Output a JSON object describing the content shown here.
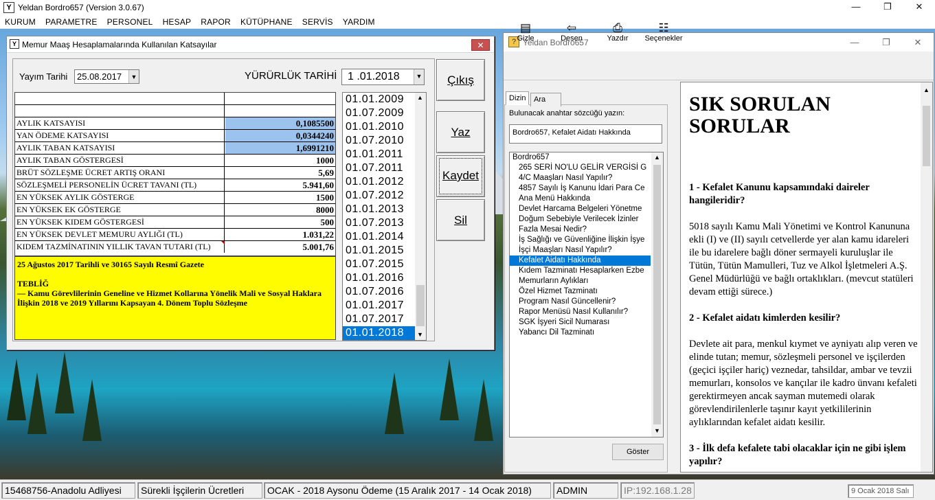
{
  "app": {
    "title": "Yeldan Bordro657 (Version 3.0.67)"
  },
  "menu": [
    "KURUM",
    "PARAMETRE",
    "PERSONEL",
    "HESAP",
    "RAPOR",
    "KÜTÜPHANE",
    "SERVİS",
    "YARDIM"
  ],
  "window_controls": {
    "minimize": "—",
    "maximize": "❐",
    "close": "✕"
  },
  "calc": {
    "title": "Memur Maaş Hesaplamalarında Kullanılan Katsayılar",
    "close": "✕",
    "yayim_label": "Yayım Tarihi",
    "yayim_value": "25.08.2017",
    "yururluk_label": "YÜRÜRLÜK TARİHİ",
    "yururluk_value": "1 .01.2018",
    "rows": [
      {
        "label": "AYLIK KATSAYISI",
        "value": "0,1085500"
      },
      {
        "label": "YAN ÖDEME KATSAYISI",
        "value": "0,0344240"
      },
      {
        "label": "AYLIK TABAN KATSAYISI",
        "value": "1,6991210"
      },
      {
        "label": "AYLIK TABAN GÖSTERGESİ",
        "value": "1000"
      },
      {
        "label": "BRÜT SÖZLEŞME ÜCRET ARTIŞ ORANI",
        "value": "5,69"
      },
      {
        "label": "SÖZLEŞMELİ PERSONELİN ÜCRET TAVANI (TL)",
        "value": "5.941,60"
      },
      {
        "label": "EN YÜKSEK AYLIK GÖSTERGE",
        "value": "1500"
      },
      {
        "label": "EN YÜKSEK EK GÖSTERGE",
        "value": "8000"
      },
      {
        "label": "EN YÜKSEK KIDEM GÖSTERGESİ",
        "value": "500"
      },
      {
        "label": "EN YÜKSEK DEVLET MEMURU AYLIĞI (TL)",
        "value": "1.031,22"
      },
      {
        "label": "KIDEM TAZMİNATININ YILLIK TAVAN TUTARI (TL)",
        "value": "5.001,76"
      }
    ],
    "note_line1": "25 Ağustos 2017 Tarihli ve 30165 Sayılı Resmî Gazete",
    "note_heading": "TEBLİĞ",
    "note_body": "—  Kamu Görevlilerinin Geneline ve Hizmet Kollarına Yönelik Mali ve Sosyal Haklara İlişkin 2018 ve 2019 Yıllarını Kapsayan 4. Dönem Toplu Sözleşme",
    "dates": [
      "01.01.2009",
      "01.07.2009",
      "01.01.2010",
      "01.07.2010",
      "01.01.2011",
      "01.07.2011",
      "01.01.2012",
      "01.07.2012",
      "01.01.2013",
      "01.07.2013",
      "01.01.2014",
      "01.01.2015",
      "01.07.2015",
      "01.01.2016",
      "01.07.2016",
      "01.01.2017",
      "01.07.2017",
      "01.01.2018"
    ],
    "selected_date": "01.01.2018",
    "buttons": {
      "cikis": "Çıkış",
      "yaz": "Yaz",
      "kaydet": "Kaydet",
      "sil": "Sil"
    }
  },
  "help": {
    "title": "Yeldan Bordro657",
    "toolbar": [
      {
        "icon": "hide-icon",
        "glyph": "▤",
        "label": "Gizle"
      },
      {
        "icon": "back-icon",
        "glyph": "⇦",
        "label": "Desen"
      },
      {
        "icon": "print-icon",
        "glyph": "⎙",
        "label": "Yazdır"
      },
      {
        "icon": "options-icon",
        "glyph": "☷",
        "label": "Seçenekler"
      }
    ],
    "tabs": [
      "Dizin",
      "Ara"
    ],
    "search_label": "Bulunacak anahtar sözcüğü yazın:",
    "search_value": "Bordro657, Kefalet Aidatı Hakkında",
    "topics_root": "Bordro657",
    "topics": [
      "265 SERİ NO'LU GELİR VERGİSİ G",
      "4/C Maaşları Nasıl Yapılır?",
      "4857 Sayılı İş Kanunu İdari Para Ce",
      "Ana Menü Hakkında",
      "Devlet Harcama Belgeleri Yönetme",
      "Doğum Sebebiyle Verilecek İzinler",
      "Fazla Mesai Nedir?",
      "İş Sağlığı ve Güvenliğine İlişkin İşye",
      "İşçi Maaşları Nasıl Yapılır?",
      "Kefalet Aidatı Hakkında",
      "Kıdem Tazminatı Hesaplarken Ezbe",
      "Memurların Aylıkları",
      "Özel Hizmet Tazminatı",
      "Program Nasıl Güncellenir?",
      "Rapor Menüsü Nasıl Kullanılır?",
      "SGK İşyeri Sicil Numarası",
      "Yabancı Dil Tazminatı"
    ],
    "selected_topic": "Kefalet Aidatı Hakkında",
    "goster": "Göster",
    "content": {
      "heading": "SIK SORULAN SORULAR",
      "q1": "1 - Kefalet Kanunu kapsamındaki daireler hangileridir?",
      "a1": "5018 sayılı Kamu Mali Yönetimi ve Kontrol Kanununa ekli (I) ve (II) sayılı cetvellerde yer alan kamu idareleri ile bu idarelere bağlı döner sermayeli kuruluşlar ile Tütün, Tütün Mamulleri, Tuz ve Alkol İşletmeleri A.Ş. Genel Müdürlüğü ve bağlı ortaklıkları. (mevcut statüleri devam ettiği sürece.)",
      "q2": "2 - Kefalet aidatı kimlerden kesilir?",
      "a2": "Devlete ait para, menkul kıymet ve ayniyatı alıp veren ve elinde tutan; memur, sözleşmeli personel ve işçilerden (geçici işçiler hariç) veznedar, tahsildar, ambar ve tevzii memurları, konsolos ve kançılar ile kadro ünvanı kefaleti gerektirmeyen ancak sayman mutemedi olarak görevlendirilenlerle taşınır kayıt yetkililerinin aylıklarından kefalet aidatı kesilir.",
      "q3": "3 - İlk defa kefalete tabi olacaklar için ne gibi işlem yapılır?"
    }
  },
  "status": {
    "kurum": "15468756-Anadolu Adliyesi",
    "mode": "Sürekli İşçilerin Ücretleri",
    "period": "OCAK - 2018 Aysonu Ödeme (15 Aralık 2017 - 14 Ocak 2018)",
    "user": "ADMIN",
    "ip": "IP:192.168.1.28",
    "date": "9 Ocak 2018 Salı"
  }
}
